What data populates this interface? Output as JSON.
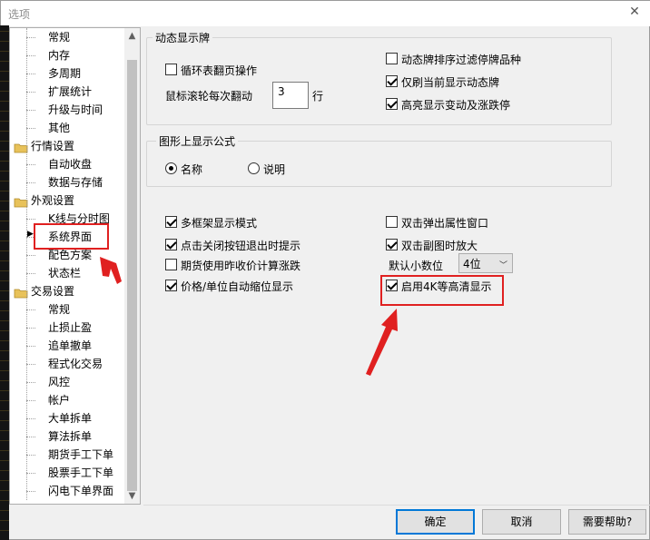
{
  "window": {
    "title": "选项",
    "close_icon": "close-icon"
  },
  "tree": {
    "items": [
      {
        "label": "常规",
        "level": 2
      },
      {
        "label": "内存",
        "level": 2
      },
      {
        "label": "多周期",
        "level": 2
      },
      {
        "label": "扩展统计",
        "level": 2
      },
      {
        "label": "升级与时间",
        "level": 2
      },
      {
        "label": "其他",
        "level": 2
      },
      {
        "label": "行情设置",
        "level": 1
      },
      {
        "label": "自动收盘",
        "level": 2
      },
      {
        "label": "数据与存储",
        "level": 2
      },
      {
        "label": "外观设置",
        "level": 1
      },
      {
        "label": "K线与分时图",
        "level": 2
      },
      {
        "label": "系统界面",
        "level": 2,
        "selected": true
      },
      {
        "label": "配色方案",
        "level": 2
      },
      {
        "label": "状态栏",
        "level": 2
      },
      {
        "label": "交易设置",
        "level": 1
      },
      {
        "label": "常规",
        "level": 2
      },
      {
        "label": "止损止盈",
        "level": 2
      },
      {
        "label": "追单撤单",
        "level": 2
      },
      {
        "label": "程式化交易",
        "level": 2
      },
      {
        "label": "风控",
        "level": 2
      },
      {
        "label": "帐户",
        "level": 2
      },
      {
        "label": "大单拆单",
        "level": 2
      },
      {
        "label": "算法拆单",
        "level": 2
      },
      {
        "label": "期货手工下单",
        "level": 2
      },
      {
        "label": "股票手工下单",
        "level": 2
      },
      {
        "label": "闪电下单界面",
        "level": 2
      }
    ]
  },
  "ticker_group": {
    "title": "动态显示牌",
    "loop_page": {
      "label": "循环表翻页操作",
      "checked": false
    },
    "scroll_label": "鼠标滚轮每次翻动",
    "scroll_value": "3",
    "scroll_unit": "行",
    "filter_halt": {
      "label": "动态牌排序过滤停牌品种",
      "checked": false
    },
    "refresh_current": {
      "label": "仅刷当前显示动态牌",
      "checked": true
    },
    "highlight_change": {
      "label": "高亮显示变动及涨跌停",
      "checked": true
    }
  },
  "formula_group": {
    "title": "图形上显示公式",
    "name_option": {
      "label": "名称",
      "selected": true
    },
    "desc_option": {
      "label": "说明",
      "selected": false
    }
  },
  "options": {
    "multi_frame": {
      "label": "多框架显示模式",
      "checked": true
    },
    "close_exit_prompt": {
      "label": "点击关闭按钮退出时提示",
      "checked": true
    },
    "futures_prev_close": {
      "label": "期货使用昨收价计算涨跌",
      "checked": false
    },
    "price_unit_shrink": {
      "label": "价格/单位自动缩位显示",
      "checked": true
    },
    "dblclick_popup": {
      "label": "双击弹出属性窗口",
      "checked": false
    },
    "dblclick_zoom": {
      "label": "双击副图时放大",
      "checked": true
    },
    "decimals_label": "默认小数位",
    "decimals_value": "4位",
    "enable_4k": {
      "label": "启用4K等高清显示",
      "checked": true
    }
  },
  "buttons": {
    "ok": "确定",
    "cancel": "取消",
    "help": "需要帮助?"
  },
  "colors": {
    "annotation_red": "#e02020",
    "folder_yellow": "#e8c25a"
  }
}
